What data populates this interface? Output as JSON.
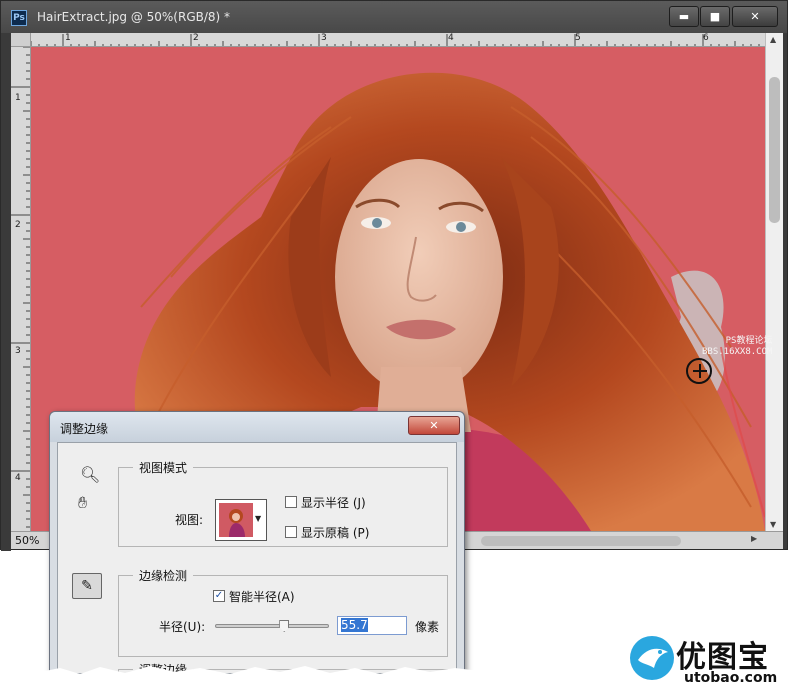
{
  "window": {
    "app_icon_label": "Ps",
    "title": "HairExtract.jpg @ 50%(RGB/8) *",
    "minimize": "▬",
    "maximize": "■",
    "close": "✕"
  },
  "rulers": {
    "top_ticks": [
      "1",
      "2",
      "3",
      "4",
      "5",
      "6"
    ],
    "left_ticks": [
      "1",
      "2",
      "3",
      "4"
    ]
  },
  "status": {
    "zoom": "50%"
  },
  "dialog": {
    "title": "调整边缘",
    "close": "✕",
    "view_mode": {
      "legend": "视图模式",
      "view_label": "视图:",
      "show_radius": "显示半径 (J)",
      "show_radius_checked": false,
      "show_original": "显示原稿 (P)",
      "show_original_checked": false
    },
    "edge_detection": {
      "legend": "边缘检测",
      "smart_radius": "智能半径(A)",
      "smart_radius_checked": true,
      "radius_label": "半径(U):",
      "radius_value": "55.7",
      "radius_unit": "像素",
      "radius_fraction": 0.62
    },
    "adjust_edge": {
      "legend": "调整边缘"
    }
  },
  "watermarks": {
    "ps_line1": "PS教程论坛",
    "ps_line2": "BBS.16XX8.COM",
    "logo_text": "优图宝",
    "logo_url": "utobao.com"
  },
  "colors": {
    "background": "#d65d63",
    "hair": "#b4481f",
    "shirt": "#c23a5c",
    "accent_select": "#3476d2"
  }
}
